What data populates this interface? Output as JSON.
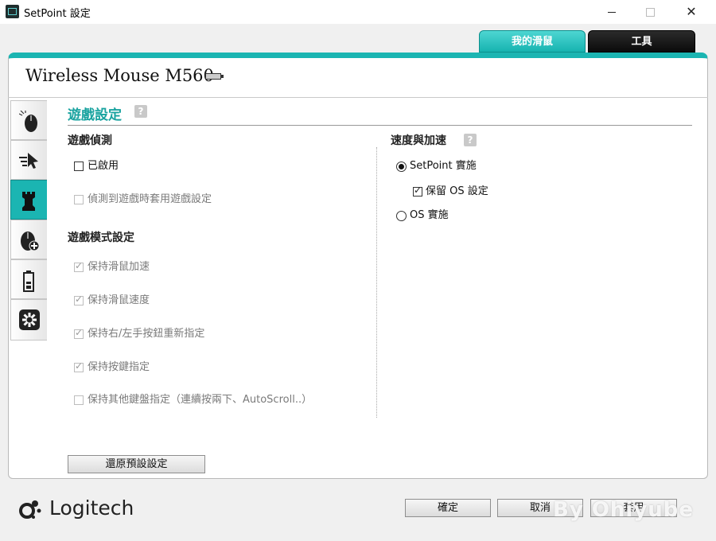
{
  "window": {
    "title": "SetPoint 設定"
  },
  "tabs": [
    {
      "label": "我的滑鼠"
    },
    {
      "label": "工具"
    }
  ],
  "device": {
    "name": "Wireless Mouse M560"
  },
  "sidebar": {
    "items": [
      "mouse-buttons",
      "pointer",
      "game-mode",
      "mouse-add",
      "battery",
      "settings"
    ],
    "active": "game-mode"
  },
  "section": {
    "title": "遊戲設定",
    "help": "?"
  },
  "game_detection": {
    "heading": "遊戲偵測",
    "enabled_label": "已啟用",
    "apply_label": "偵測到遊戲時套用遊戲設定"
  },
  "game_mode": {
    "heading": "遊戲模式設定",
    "options": [
      "保持滑鼠加速",
      "保持滑鼠速度",
      "保持右/左手按鈕重新指定",
      "保持按鍵指定",
      "保持其他鍵盤指定（連續按兩下、AutoScroll..）"
    ]
  },
  "acceleration": {
    "heading": "速度與加速",
    "help": "?",
    "setpoint_label": "SetPoint 實施",
    "keep_os_label": "保留 OS 設定",
    "os_label": "OS 實施"
  },
  "buttons": {
    "restore": "還原預設設定",
    "ok": "確定",
    "cancel": "取消",
    "apply": "套用"
  },
  "brand": {
    "logo": "Logitech"
  },
  "watermark": "By Ohiyube",
  "colors": {
    "accent": "#1bb5b2",
    "tab_dark": "#111111"
  }
}
